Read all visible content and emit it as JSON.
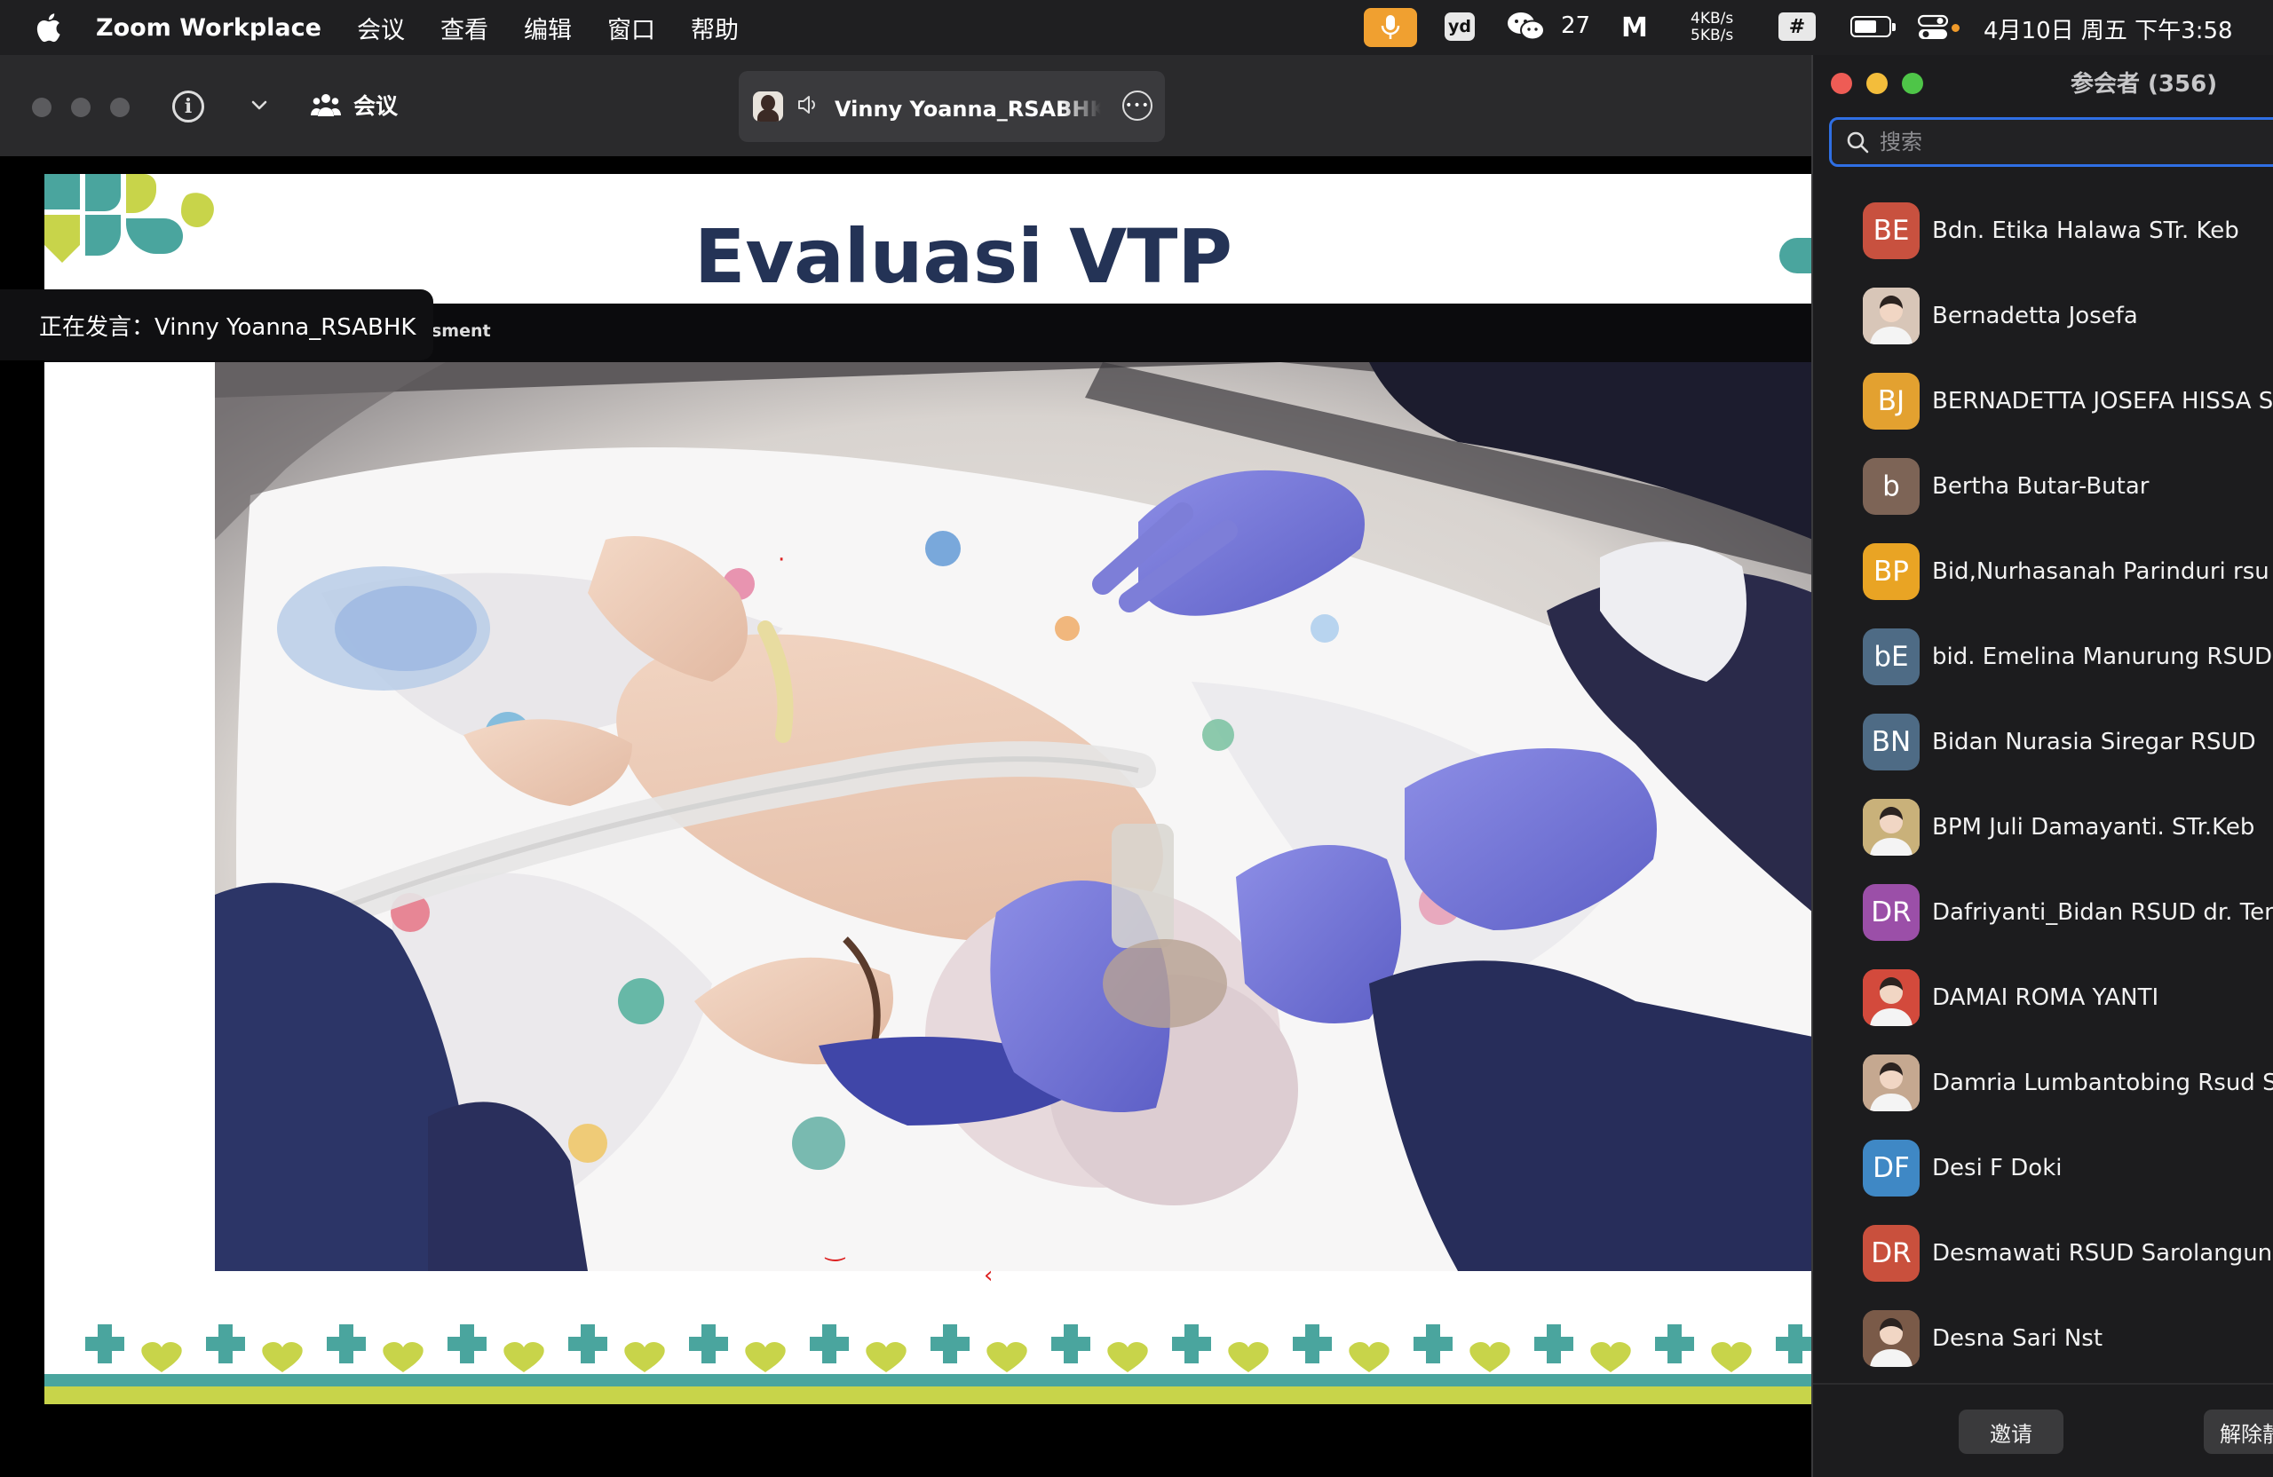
{
  "menubar": {
    "app_name": "Zoom Workplace",
    "menus": [
      "会议",
      "查看",
      "编辑",
      "窗口",
      "帮助"
    ],
    "yd_label": "yd",
    "wechat_count": "27",
    "m_label": "M",
    "net_up": "4KB/s",
    "net_down": "5KB/s",
    "hash_label": "#",
    "clock": "4月10日 周五 下午3:58",
    "mic_color": "#f0a030"
  },
  "toolbar": {
    "meeting_label": "会议",
    "speaker_name": "Vinny Yoanna_RSABHK的"
  },
  "slide": {
    "title": "Evaluasi VTP",
    "assessment_label": "sment",
    "title_color": "#243356"
  },
  "tooltip": {
    "text": "正在发言：Vinny Yoanna_RSABHK"
  },
  "participants": {
    "title": "参会者 (356)",
    "search_placeholder": "搜索",
    "invite_label": "邀请",
    "unmute_label": "解除静",
    "list": [
      {
        "initials": "BE",
        "name": "Bdn. Etika Halawa STr. Keb",
        "color": "#c8513f",
        "photo": false
      },
      {
        "initials": "",
        "name": "Bernadetta Josefa",
        "color": "#d8c6b8",
        "photo": true
      },
      {
        "initials": "BJ",
        "name": "BERNADETTA JOSEFA HISSA S",
        "color": "#e3a130",
        "photo": false
      },
      {
        "initials": "b",
        "name": "Bertha Butar-Butar",
        "color": "#7d6456",
        "photo": false
      },
      {
        "initials": "BP",
        "name": "Bid,Nurhasanah Parinduri rsu Su",
        "color": "#e9a424",
        "photo": false
      },
      {
        "initials": "bE",
        "name": "bid. Emelina Manurung RSUD Su",
        "color": "#4e6b85",
        "photo": false
      },
      {
        "initials": "BN",
        "name": "Bidan Nurasia Siregar RSUD",
        "color": "#4e6b85",
        "photo": false
      },
      {
        "initials": "",
        "name": "BPM Juli Damayanti. STr.Keb",
        "color": "#c9b17a",
        "photo": true
      },
      {
        "initials": "DR",
        "name": "Dafriyanti_Bidan RSUD dr. Tengk",
        "color": "#9b4fa8",
        "photo": false
      },
      {
        "initials": "",
        "name": "DAMAI ROMA YANTI",
        "color": "#d34a3c",
        "photo": true
      },
      {
        "initials": "",
        "name": "Damria Lumbantobing Rsud Sala",
        "color": "#c5a890",
        "photo": true
      },
      {
        "initials": "DF",
        "name": "Desi F Doki",
        "color": "#3f88c5",
        "photo": false
      },
      {
        "initials": "DR",
        "name": "Desmawati RSUD Sarolangun",
        "color": "#c9503d",
        "photo": false
      },
      {
        "initials": "",
        "name": "Desna Sari Nst",
        "color": "#7a5a48",
        "photo": true
      }
    ]
  }
}
